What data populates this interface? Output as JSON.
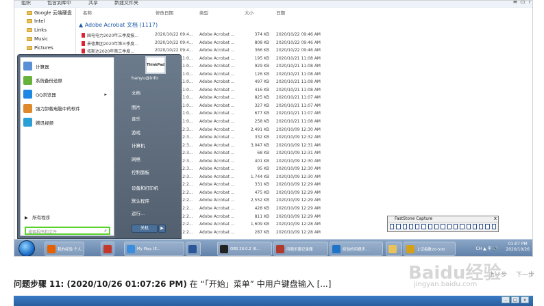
{
  "window": {
    "toolbar": [
      "组织",
      "包含到库中",
      "共享",
      "新建文件夹"
    ],
    "controls": [
      "≡",
      "▭",
      "?"
    ]
  },
  "nav_pane": [
    "Google 云端硬盘",
    "Intel",
    "Links",
    "Music",
    "Pictures"
  ],
  "columns": [
    "名称",
    "修改日期",
    "类型",
    "大小",
    "日期"
  ],
  "group_header": "Adobe Acrobat 文档 (1117)",
  "files": [
    {
      "name": "国电电力2020年三季度报...",
      "modified": "2020/10/22 09:4...",
      "type": "Adobe Acrobat ...",
      "size": "374 KB",
      "date": "2020/10/22 09:46 AM"
    },
    {
      "name": "景德集团2020年第三季度...",
      "modified": "2020/10/22 09:4...",
      "type": "Adobe Acrobat ...",
      "size": "808 KB",
      "date": "2020/10/22 09:46 AM"
    },
    {
      "name": "拓斯达2020年第三季度...",
      "modified": "2020/10/22 09:4...",
      "type": "Adobe Acrobat ...",
      "size": "366 KB",
      "date": "2020/10/22 09:46 AM"
    },
    {
      "name": "",
      "modified": "2020/10/21 11:0...",
      "type": "Adobe Acrobat ...",
      "size": "195 KB",
      "date": "2020/10/21 11:08 AM"
    },
    {
      "name": "",
      "modified": "2020/10/21 11:0...",
      "type": "Adobe Acrobat ...",
      "size": "929 KB",
      "date": "2020/10/21 11:08 AM"
    },
    {
      "name": "",
      "modified": "2020/10/21 11:0...",
      "type": "Adobe Acrobat ...",
      "size": "126 KB",
      "date": "2020/10/21 11:08 AM"
    },
    {
      "name": "",
      "modified": "2020/10/21 11:0...",
      "type": "Adobe Acrobat ...",
      "size": "497 KB",
      "date": "2020/10/21 11:08 AM"
    },
    {
      "name": "",
      "modified": "2020/10/21 11:0...",
      "type": "Adobe Acrobat ...",
      "size": "416 KB",
      "date": "2020/10/21 11:08 AM"
    },
    {
      "name": "",
      "modified": "2020/10/21 11:0...",
      "type": "Adobe Acrobat ...",
      "size": "825 KB",
      "date": "2020/10/21 11:07 AM"
    },
    {
      "name": "",
      "modified": "2020/10/21 11:0...",
      "type": "Adobe Acrobat ...",
      "size": "327 KB",
      "date": "2020/10/21 11:07 AM"
    },
    {
      "name": "",
      "modified": "2020/10/21 11:0...",
      "type": "Adobe Acrobat ...",
      "size": "677 KB",
      "date": "2020/10/21 11:07 AM"
    },
    {
      "name": "",
      "modified": "2020/10/21 11:0...",
      "type": "Adobe Acrobat ...",
      "size": "258 KB",
      "date": "2020/10/21 11:08 AM"
    },
    {
      "name": "",
      "modified": "2020/10/09 12:3...",
      "type": "Adobe Acrobat ...",
      "size": "2,491 KB",
      "date": "2020/10/09 12:30 AM"
    },
    {
      "name": "",
      "modified": "2020/10/09 12:3...",
      "type": "Adobe Acrobat ...",
      "size": "332 KB",
      "date": "2020/10/09 12:32 AM"
    },
    {
      "name": "",
      "modified": "2020/10/09 12:3...",
      "type": "Adobe Acrobat ...",
      "size": "3,047 KB",
      "date": "2020/10/09 12:31 AM"
    },
    {
      "name": "",
      "modified": "2020/10/09 12:3...",
      "type": "Adobe Acrobat ...",
      "size": "68 KB",
      "date": "2020/10/09 12:31 AM"
    },
    {
      "name": "",
      "modified": "2020/10/09 12:3...",
      "type": "Adobe Acrobat ...",
      "size": "401 KB",
      "date": "2020/10/09 12:30 AM"
    },
    {
      "name": "",
      "modified": "2020/10/09 12:3...",
      "type": "Adobe Acrobat ...",
      "size": "95 KB",
      "date": "2020/10/09 12:30 AM"
    },
    {
      "name": "",
      "modified": "2020/10/09 12:3...",
      "type": "Adobe Acrobat ...",
      "size": "1,744 KB",
      "date": "2020/10/09 12:30 AM"
    },
    {
      "name": "",
      "modified": "2020/10/09 12:2...",
      "type": "Adobe Acrobat ...",
      "size": "331 KB",
      "date": "2020/10/09 12:29 AM"
    },
    {
      "name": "",
      "modified": "2020/10/09 12:2...",
      "type": "Adobe Acrobat ...",
      "size": "475 KB",
      "date": "2020/10/09 12:29 AM"
    },
    {
      "name": "",
      "modified": "2020/10/09 12:2...",
      "type": "Adobe Acrobat ...",
      "size": "2,552 KB",
      "date": "2020/10/09 12:29 AM"
    },
    {
      "name": "",
      "modified": "2020/10/09 12:2...",
      "type": "Adobe Acrobat ...",
      "size": "428 KB",
      "date": "2020/10/09 12:29 AM"
    },
    {
      "name": "",
      "modified": "2020/10/09 12:2...",
      "type": "Adobe Acrobat ...",
      "size": "811 KB",
      "date": "2020/10/09 12:29 AM"
    },
    {
      "name": "",
      "modified": "2020/10/09 12:2...",
      "type": "Adobe Acrobat ...",
      "size": "1,609 KB",
      "date": "2020/10/09 12:28 AM"
    },
    {
      "name": "",
      "modified": "2020/10/09 12:2...",
      "type": "Adobe Acrobat ...",
      "size": "287 KB",
      "date": "2020/10/09 12:28 AM"
    }
  ],
  "start_menu": {
    "programs": [
      {
        "label": "计算器",
        "icon": "calculator-icon",
        "color": "#5a8fd6"
      },
      {
        "label": "系统备份还原",
        "icon": "backup-icon",
        "color": "#66b23a"
      },
      {
        "label": "QQ浏览器",
        "icon": "qq-browser-icon",
        "color": "#1e88e5",
        "has_submenu": true
      },
      {
        "label": "强力卸载电脑中的软件",
        "icon": "uninstall-icon",
        "color": "#e0892b"
      },
      {
        "label": "腾讯视频",
        "icon": "tencent-video-icon",
        "color": "#2a9fd6"
      }
    ],
    "all_programs": "所有程序",
    "search_placeholder": "搜索程序和文件",
    "user_picture": "ThinkPad",
    "right_items": [
      "hanyu@info",
      "文档",
      "图片",
      "音乐",
      "游戏",
      "计算机",
      "网络",
      "控制面板",
      "设备和打印机",
      "默认程序",
      "运行..."
    ],
    "shutdown": "关机",
    "shutdown_arrow": "▶"
  },
  "faststone": {
    "title": "FastStone Capture",
    "close": "x"
  },
  "taskbar": {
    "items": [
      {
        "label": "我的经验 个人...",
        "icon": "firefox-icon",
        "color": "#e66000"
      },
      {
        "label": "",
        "icon": "app-icon",
        "color": "#c0392b"
      },
      {
        "label": "My Way (E...",
        "icon": "browser-icon",
        "color": "#3b8ede"
      },
      {
        "label": "",
        "icon": "word-icon",
        "color": "#2b579a"
      },
      {
        "label": "OBS 26.0.2 (6...",
        "icon": "obs-icon",
        "color": "#222222"
      },
      {
        "label": "问题步骤记录器",
        "icon": "steps-recorder-icon",
        "color": "#b03a2e"
      },
      {
        "label": "经验的问题步...",
        "icon": "ie-icon",
        "color": "#1f74c8"
      },
      {
        "label": "",
        "icon": "folder-icon",
        "color": "#e9c25a"
      },
      {
        "label": "上证指数20-500",
        "icon": "stock-icon",
        "color": "#d4a017"
      }
    ],
    "tray_text": "CH ▲ 中 🔊",
    "time": "01:07 PM",
    "date": "2020/10/26"
  },
  "caption": {
    "prefix": "问题步骤",
    "step": "11: (2020/10/26 01:07:26 PM)",
    "text": "在 “「开始」菜单” 中用户键盘输入",
    "more": "[...]"
  },
  "nav_links": {
    "prev": "上一步",
    "next": "下一步"
  },
  "watermark": {
    "brand": "Baidu经验",
    "url": "jingyan.baidu.com"
  }
}
